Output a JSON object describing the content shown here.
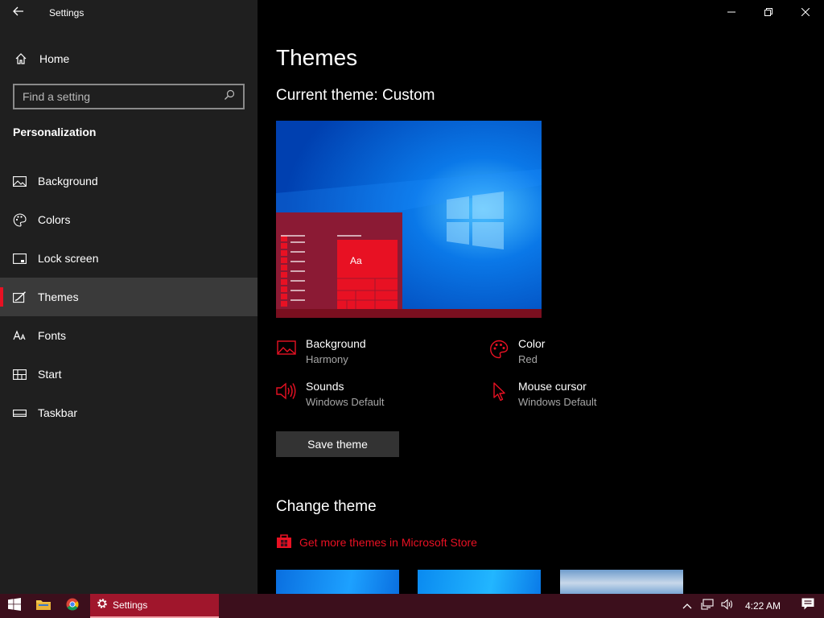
{
  "window": {
    "title": "Settings"
  },
  "sidebar": {
    "home_label": "Home",
    "search_placeholder": "Find a setting",
    "section_title": "Personalization",
    "items": [
      {
        "label": "Background",
        "icon": "picture-icon"
      },
      {
        "label": "Colors",
        "icon": "palette-icon"
      },
      {
        "label": "Lock screen",
        "icon": "lock-screen-icon"
      },
      {
        "label": "Themes",
        "icon": "themes-icon",
        "active": true
      },
      {
        "label": "Fonts",
        "icon": "fonts-icon"
      },
      {
        "label": "Start",
        "icon": "start-icon"
      },
      {
        "label": "Taskbar",
        "icon": "taskbar-icon"
      }
    ]
  },
  "main": {
    "title": "Themes",
    "current_theme": "Current theme: Custom",
    "preview_sample_text": "Aa",
    "attributes": {
      "background": {
        "title": "Background",
        "value": "Harmony"
      },
      "color": {
        "title": "Color",
        "value": "Red"
      },
      "sounds": {
        "title": "Sounds",
        "value": "Windows Default"
      },
      "mouse_cursor": {
        "title": "Mouse cursor",
        "value": "Windows Default"
      }
    },
    "save_button": "Save theme",
    "change_theme_title": "Change theme",
    "store_link": "Get more themes in Microsoft Store"
  },
  "taskbar": {
    "active_app_label": "Settings",
    "time": "4:22 AM"
  },
  "colors": {
    "accent": "#e81123",
    "sidebar_bg": "#1f1f1f",
    "main_bg": "#000000",
    "taskbar_bg": "#3c0f1c",
    "taskbar_active": "#a0162c"
  }
}
